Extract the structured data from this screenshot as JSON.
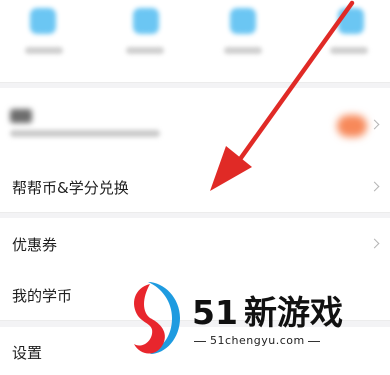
{
  "menu": {
    "exchange_label": "帮帮币&学分兑换",
    "coupons_label": "优惠券",
    "my_coins_label": "我的学币",
    "settings_label": "设置"
  },
  "watermark": {
    "brand_digits": "51",
    "brand_name": "新游戏",
    "url": "51chengyu.com"
  },
  "colors": {
    "annotation_arrow": "#e02a26",
    "icon_blue": "#5cc0f2",
    "logo_red": "#e8262d",
    "logo_blue": "#1e9be0"
  },
  "icons": [
    "chevron-right-icon",
    "annotation-arrow-icon",
    "brand-logo-icon"
  ]
}
